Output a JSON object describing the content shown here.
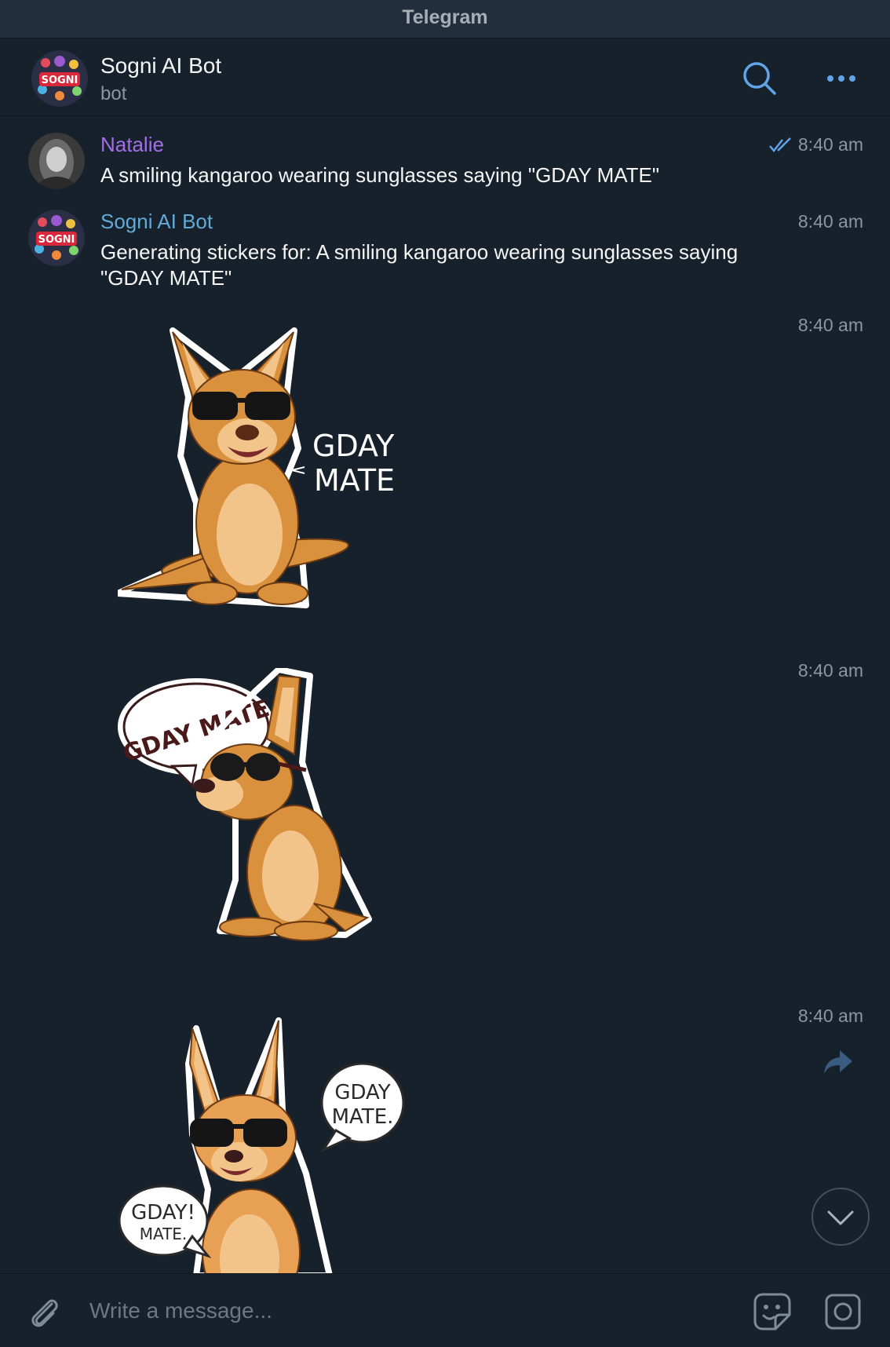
{
  "app": {
    "title": "Telegram"
  },
  "header": {
    "name": "Sogni AI Bot",
    "status": "bot"
  },
  "messages": [
    {
      "sender": "Natalie",
      "sender_color": "#a36ee8",
      "text": "A smiling kangaroo wearing sunglasses saying \"GDAY MATE\"",
      "time": "8:40 am",
      "read": true
    },
    {
      "sender": "Sogni AI Bot",
      "sender_color": "#62a9d7",
      "text": "Generating stickers for: A smiling kangaroo wearing sunglasses saying \"GDAY MATE\"",
      "time": "8:40 am"
    }
  ],
  "stickers": [
    {
      "time": "8:40 am",
      "caption_lines": [
        "GDAY",
        "MATE"
      ]
    },
    {
      "time": "8:40 am",
      "caption_lines": [
        "GDAY MATE"
      ]
    },
    {
      "time": "8:40 am",
      "caption_lines": [
        "GDAY",
        "MATE.",
        "GDAY!",
        "MATE."
      ]
    }
  ],
  "composer": {
    "placeholder": "Write a message..."
  },
  "colors": {
    "background": "#17212b",
    "accent": "#5288c1",
    "secondary_text": "#8b96a3",
    "kangaroo_fur": "#d9913e"
  },
  "icons": [
    "search-icon",
    "more-icon",
    "double-check-icon",
    "forward-icon",
    "chevron-down-icon",
    "paperclip-icon",
    "sticker-icon",
    "camera-icon"
  ]
}
